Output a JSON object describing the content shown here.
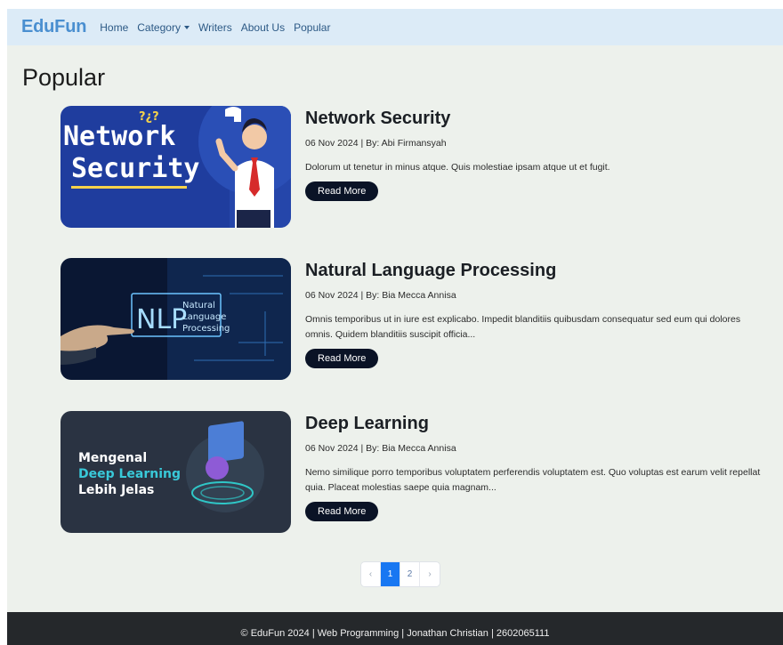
{
  "nav": {
    "brand": "EduFun",
    "links": [
      "Home",
      "Category",
      "Writers",
      "About Us",
      "Popular"
    ]
  },
  "page_title": "Popular",
  "articles": [
    {
      "title": "Network Security",
      "meta": "06 Nov 2024 | By: Abi Firmansyah",
      "excerpt": "Dolorum ut tenetur in minus atque. Quis molestiae ipsam atque ut et fugit.",
      "button": "Read More",
      "image": {
        "line1": "Network",
        "line2": "Security",
        "marks": "?¿?"
      }
    },
    {
      "title": "Natural Language Processing",
      "meta": "06 Nov 2024 | By: Bia Mecca Annisa",
      "excerpt": "Omnis temporibus ut in iure est explicabo. Impedit blanditiis quibusdam consequatur sed eum qui dolores omnis. Quidem blanditiis suscipit officia...",
      "button": "Read More",
      "image": {
        "abbr": "NLP",
        "line1": "Natural",
        "line2": "Language",
        "line3": "Processing"
      }
    },
    {
      "title": "Deep Learning",
      "meta": "06 Nov 2024 | By: Bia Mecca Annisa",
      "excerpt": "Nemo similique porro temporibus voluptatem perferendis voluptatem est. Quo voluptas est earum velit repellat quia. Placeat molestias saepe quia magnam...",
      "button": "Read More",
      "image": {
        "line1": "Mengenal",
        "line2": "Deep Learning",
        "line3": "Lebih Jelas"
      }
    }
  ],
  "pagination": {
    "prev": "‹",
    "pages": [
      "1",
      "2"
    ],
    "current": "1",
    "next": "›"
  },
  "footer": "© EduFun 2024 | Web Programming | Jonathan Christian | 2602065111",
  "colors": {
    "brand": "#4a8fd0",
    "navbar_bg": "#dcebf7",
    "page_bg": "#edf1ec",
    "button_bg": "#0a1326",
    "active_page": "#1877f2",
    "footer_bg": "#25282b"
  }
}
